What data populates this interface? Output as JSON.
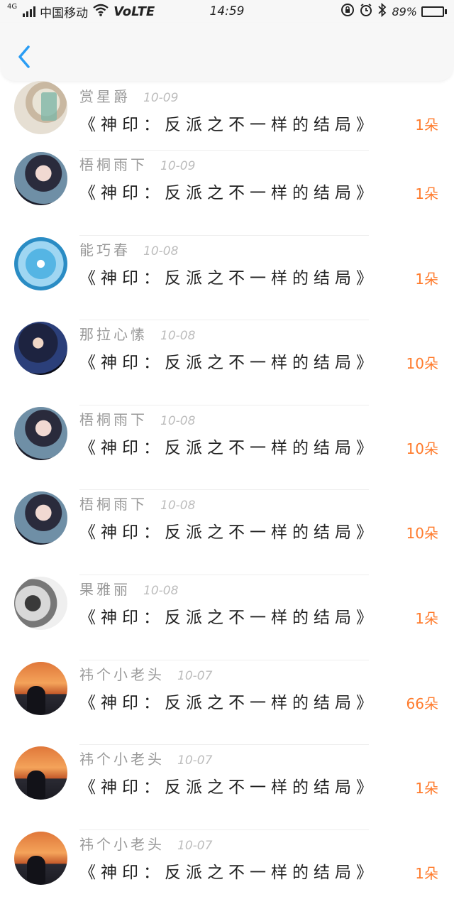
{
  "status_bar": {
    "network": "4G",
    "carrier": "中国移动",
    "volte": "VoLTE",
    "time": "14:59",
    "battery_percent": "89%",
    "battery_level": 0.89,
    "icons": [
      "signal-icon",
      "wifi-icon",
      "rotation-lock-icon",
      "alarm-icon",
      "bluetooth-icon",
      "battery-icon"
    ]
  },
  "nav": {
    "back_icon": "chevron-left-icon",
    "accent": "#2a9df4"
  },
  "colors": {
    "amount": "#ff7b2c",
    "name": "#9a9a9a",
    "date": "#bdbdbd",
    "title": "#222222"
  },
  "list": [
    {
      "name": "赏星爵",
      "date": "10-09",
      "title": "《神印：反派之不一样的结局》",
      "amount": "1朵",
      "avatar": "room-photo"
    },
    {
      "name": "梧桐雨下",
      "date": "10-09",
      "title": "《神印：反派之不一样的结局》",
      "amount": "1朵",
      "avatar": "anime-girl"
    },
    {
      "name": "能巧春",
      "date": "10-08",
      "title": "《神印：反派之不一样的结局》",
      "amount": "1朵",
      "avatar": "snowflake"
    },
    {
      "name": "那拉心愫",
      "date": "10-08",
      "title": "《神印：反派之不一样的结局》",
      "amount": "10朵",
      "avatar": "anime-ninja"
    },
    {
      "name": "梧桐雨下",
      "date": "10-08",
      "title": "《神印：反派之不一样的结局》",
      "amount": "10朵",
      "avatar": "anime-girl"
    },
    {
      "name": "梧桐雨下",
      "date": "10-08",
      "title": "《神印：反派之不一样的结局》",
      "amount": "10朵",
      "avatar": "anime-girl"
    },
    {
      "name": "果雅丽",
      "date": "10-08",
      "title": "《神印：反派之不一样的结局》",
      "amount": "1朵",
      "avatar": "couple-photo"
    },
    {
      "name": "祎个小老头",
      "date": "10-07",
      "title": "《神印：反派之不一样的结局》",
      "amount": "66朵",
      "avatar": "sunset-silhouette"
    },
    {
      "name": "祎个小老头",
      "date": "10-07",
      "title": "《神印：反派之不一样的结局》",
      "amount": "1朵",
      "avatar": "sunset-silhouette"
    },
    {
      "name": "祎个小老头",
      "date": "10-07",
      "title": "《神印：反派之不一样的结局》",
      "amount": "1朵",
      "avatar": "sunset-silhouette"
    }
  ]
}
